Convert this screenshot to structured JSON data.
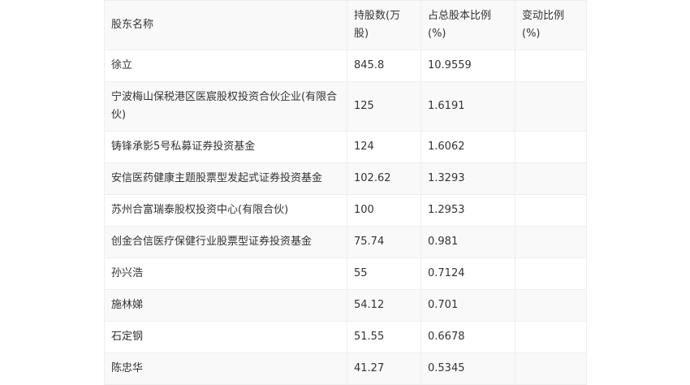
{
  "table": {
    "headers": [
      "股东名称",
      "持股数(万股)",
      "占总股本比例(%)",
      "变动比例(%)"
    ],
    "rows": [
      {
        "name": "徐立",
        "shares": "845.8",
        "ratio": "10.9559",
        "change": ""
      },
      {
        "name": "宁波梅山保税港区医宸股权投资合伙企业(有限合伙)",
        "shares": "125",
        "ratio": "1.6191",
        "change": ""
      },
      {
        "name": "铸锋承影5号私募证券投资基金",
        "shares": "124",
        "ratio": "1.6062",
        "change": ""
      },
      {
        "name": "安信医药健康主题股票型发起式证券投资基金",
        "shares": "102.62",
        "ratio": "1.3293",
        "change": ""
      },
      {
        "name": "苏州合富瑞泰股权投资中心(有限合伙)",
        "shares": "100",
        "ratio": "1.2953",
        "change": ""
      },
      {
        "name": "创金合信医疗保健行业股票型证券投资基金",
        "shares": "75.74",
        "ratio": "0.981",
        "change": ""
      },
      {
        "name": "孙兴浩",
        "shares": "55",
        "ratio": "0.7124",
        "change": ""
      },
      {
        "name": "施林娣",
        "shares": "54.12",
        "ratio": "0.701",
        "change": ""
      },
      {
        "name": "石定钢",
        "shares": "51.55",
        "ratio": "0.6678",
        "change": ""
      },
      {
        "name": "陈忠华",
        "shares": "41.27",
        "ratio": "0.5345",
        "change": ""
      }
    ]
  }
}
